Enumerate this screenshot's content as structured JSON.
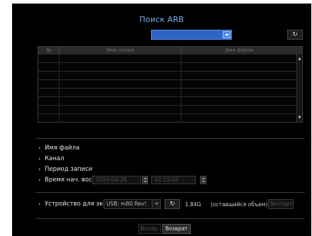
{
  "header": {
    "title": "Поиск ARB",
    "selected_value": "",
    "refresh_icon": "refresh-icon"
  },
  "table": {
    "columns": [
      "№",
      "Имя папки",
      "Имя файла"
    ],
    "rows": []
  },
  "info": {
    "file_name_label": "Имя файла",
    "channel_label": "Канал",
    "period_label": "Период записи",
    "start_time_label": "Время нач. воспр.",
    "start_date": "2016-04-28",
    "start_time": "02:19:02"
  },
  "device": {
    "label": "Устройство для экспо",
    "selected": "USB: m80 Rev!",
    "size": "1.84G",
    "remaining": "(оставшийся объем)",
    "export_label": "Экспорт"
  },
  "footer": {
    "play_label": "Воспр.",
    "return_label": "Возврат"
  },
  "colors": {
    "title": "#7db3ea",
    "accent": "#2d62c7",
    "background": "#000000"
  }
}
